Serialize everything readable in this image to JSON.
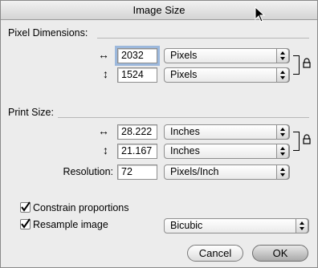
{
  "window": {
    "title": "Image Size"
  },
  "pixel_dimensions": {
    "label": "Pixel Dimensions:",
    "width": {
      "arrow": "↔",
      "value": "2032",
      "unit": "Pixels"
    },
    "height": {
      "arrow": "↕",
      "value": "1524",
      "unit": "Pixels"
    }
  },
  "print_size": {
    "label": "Print Size:",
    "width": {
      "arrow": "↔",
      "value": "28.222",
      "unit": "Inches"
    },
    "height": {
      "arrow": "↕",
      "value": "21.167",
      "unit": "Inches"
    },
    "resolution": {
      "label": "Resolution:",
      "value": "72",
      "unit": "Pixels/Inch"
    }
  },
  "options": {
    "constrain": {
      "label": "Constrain proportions",
      "checked": true
    },
    "resample": {
      "label": "Resample image",
      "checked": true,
      "method": "Bicubic"
    }
  },
  "buttons": {
    "cancel": "Cancel",
    "ok": "OK"
  }
}
